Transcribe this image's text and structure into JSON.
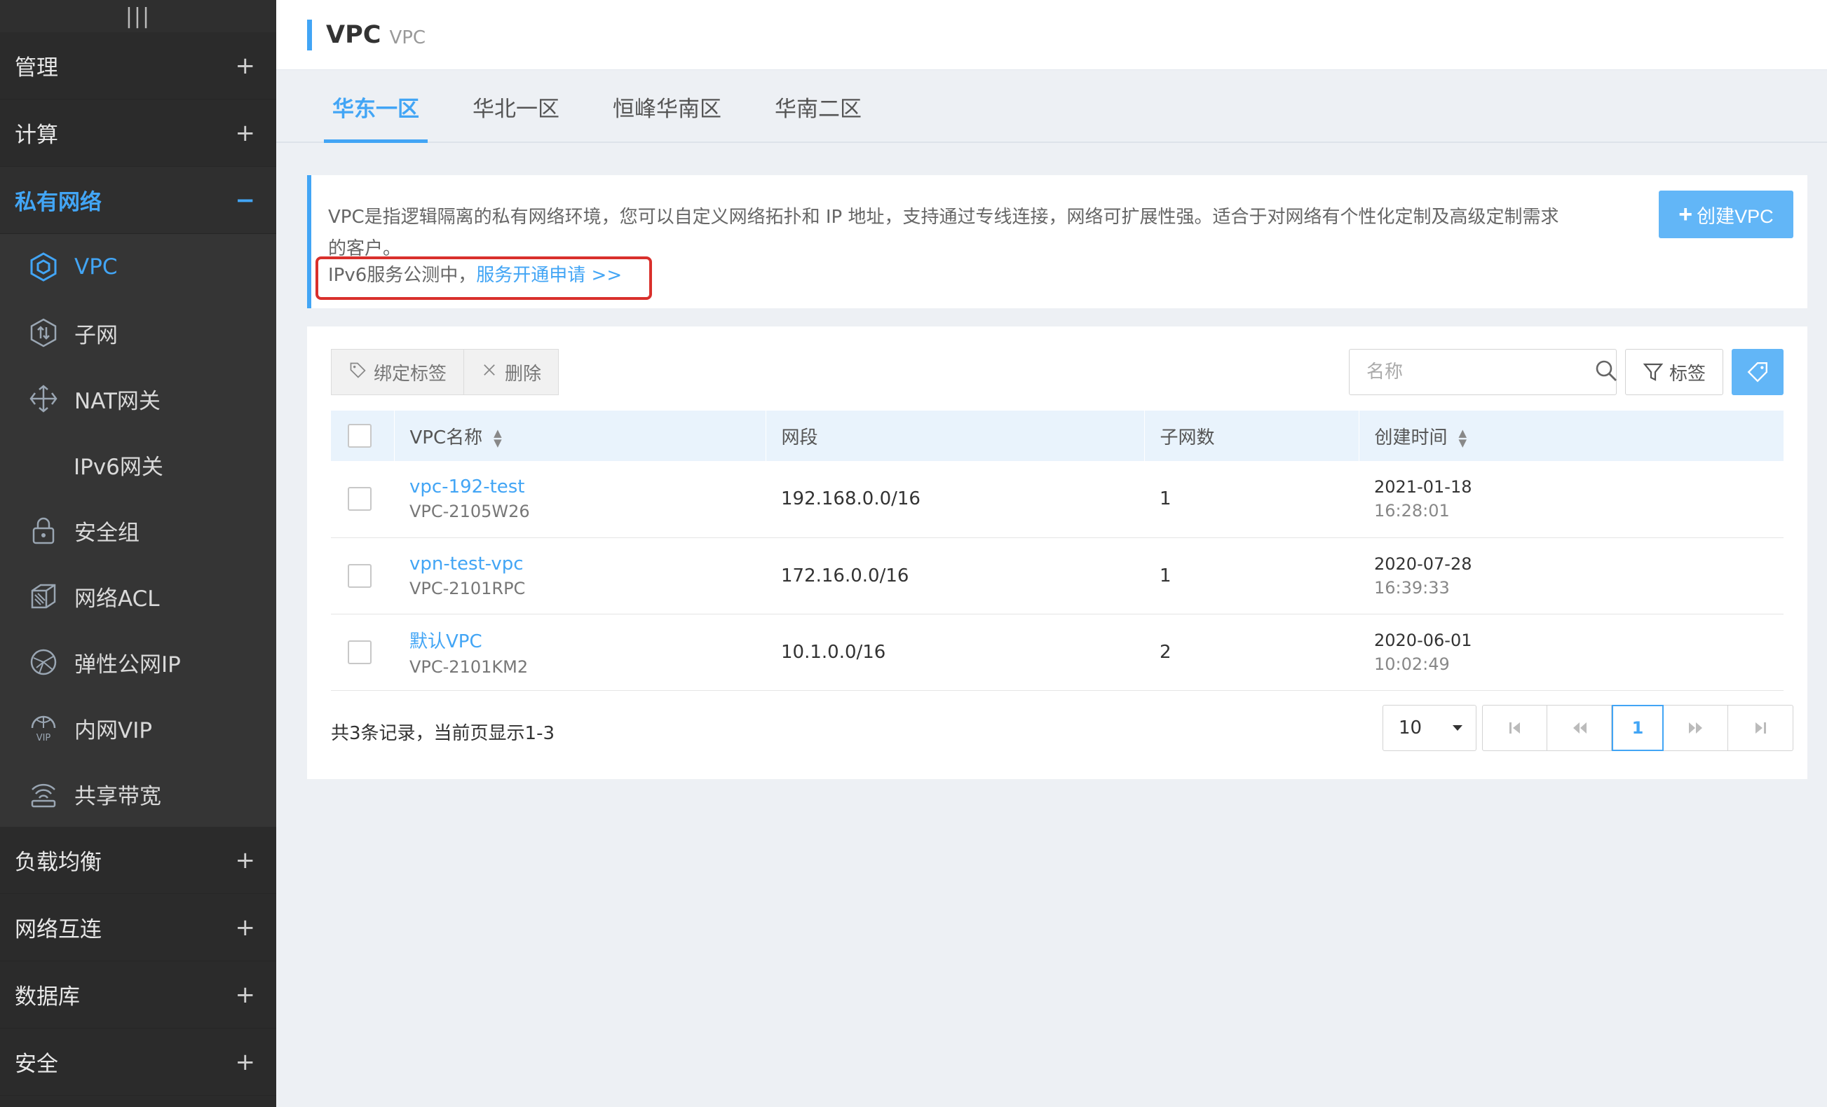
{
  "sidebar": {
    "handle": "|||",
    "groups_top": [
      {
        "label": "管理",
        "toggle": "+"
      },
      {
        "label": "计算",
        "toggle": "+"
      }
    ],
    "active_group": {
      "label": "私有网络",
      "toggle": "−"
    },
    "items": [
      {
        "label": "VPC",
        "icon": "hexagon-icon"
      },
      {
        "label": "子网",
        "icon": "subnet-icon"
      },
      {
        "label": "NAT网关",
        "icon": "nat-gateway-icon"
      },
      {
        "label": "IPv6网关",
        "icon": ""
      },
      {
        "label": "安全组",
        "icon": "lock-icon"
      },
      {
        "label": "网络ACL",
        "icon": "acl-icon"
      },
      {
        "label": "弹性公网IP",
        "icon": "globe-icon"
      },
      {
        "label": "内网VIP",
        "icon": "vip-icon"
      },
      {
        "label": "共享带宽",
        "icon": "bandwidth-icon"
      }
    ],
    "groups_bottom": [
      {
        "label": "负载均衡",
        "toggle": "+"
      },
      {
        "label": "网络互连",
        "toggle": "+"
      },
      {
        "label": "数据库",
        "toggle": "+"
      },
      {
        "label": "安全",
        "toggle": "+"
      }
    ]
  },
  "header": {
    "title": "VPC",
    "subtitle": "VPC"
  },
  "tabs": [
    "华东一区",
    "华北一区",
    "恒峰华南区",
    "华南二区"
  ],
  "info": {
    "description": "VPC是指逻辑隔离的私有网络环境，您可以自定义网络拓扑和 IP 地址，支持通过专线连接，网络可扩展性强。适合于对网络有个性化定制及高级定制需求的客户。",
    "ipv6_prefix": "IPv6服务公测中，",
    "ipv6_link": "服务开通申请 >>",
    "create_button": "创建VPC",
    "create_plus": "+"
  },
  "toolbar": {
    "bind_tag": "绑定标签",
    "delete": "删除",
    "search_placeholder": "名称",
    "tag_filter": "标签"
  },
  "table": {
    "headers": [
      "VPC名称",
      "网段",
      "子网数",
      "创建时间"
    ],
    "rows": [
      {
        "name": "vpc-192-test",
        "id": "VPC-2105W26",
        "cidr": "192.168.0.0/16",
        "subnets": "1",
        "date": "2021-01-18",
        "time": "16:28:01"
      },
      {
        "name": "vpn-test-vpc",
        "id": "VPC-2101RPC",
        "cidr": "172.16.0.0/16",
        "subnets": "1",
        "date": "2020-07-28",
        "time": "16:39:33"
      },
      {
        "name": "默认VPC",
        "id": "VPC-2101KM2",
        "cidr": "10.1.0.0/16",
        "subnets": "2",
        "date": "2020-06-01",
        "time": "10:02:49"
      }
    ]
  },
  "footer": {
    "summary": "共3条记录，当前页显示1-3",
    "page_size": "10",
    "current_page": "1"
  },
  "colors": {
    "accent": "#42a5f5",
    "sidebar_bg": "#2b2b2b",
    "highlight": "#d9302c"
  }
}
